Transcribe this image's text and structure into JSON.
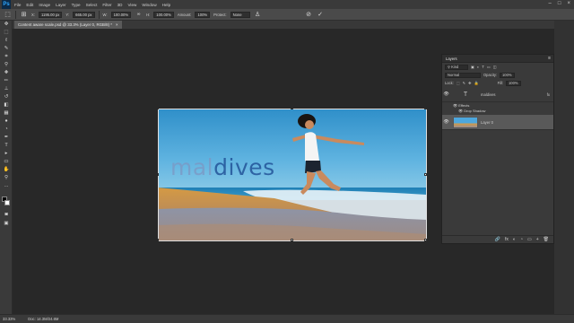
{
  "app": {
    "logo": "Ps"
  },
  "menubar": {
    "items": [
      "File",
      "Edit",
      "Image",
      "Layer",
      "Type",
      "Select",
      "Filter",
      "3D",
      "View",
      "Window",
      "Help"
    ],
    "window_buttons": [
      "–",
      "□",
      "×"
    ]
  },
  "options": {
    "x_label": "X:",
    "x_value": "1195.00 px",
    "y_label": "Y:",
    "y_value": "665.00 px",
    "w_label": "W:",
    "w_value": "100.00%",
    "h_label": "H:",
    "h_value": "100.00%",
    "angle_label": "Δ",
    "angle_value": "0.00",
    "amount_label": "Amount:",
    "amount_value": "100%",
    "protect_label": "Protect:",
    "protect_value": "None",
    "cancel_icon": "⊘",
    "commit_icon": "✓"
  },
  "document": {
    "tab_title": "Content aware scale.psd @ 33.3% (Layer 0, RGB/8) *",
    "tab_close": "×",
    "headline_part1": "mal",
    "headline_part2": "dives"
  },
  "layers_panel": {
    "title": "Layers",
    "menu_icon": "≡",
    "kind_label": "Kind",
    "blend_mode": "Normal",
    "opacity_label": "Opacity:",
    "opacity_value": "100%",
    "lock_label": "Lock:",
    "fill_label": "Fill:",
    "fill_value": "100%",
    "layers": [
      {
        "name": "maldives",
        "type": "text",
        "fx": "fx"
      },
      {
        "name": "Layer 0",
        "type": "image"
      }
    ],
    "effects_label": "Effects",
    "drop_shadow_label": "Drop Shadow",
    "footer_icons": [
      "🔗",
      "fx",
      "◐",
      "◔",
      "▭",
      "+",
      "🗑"
    ]
  },
  "status": {
    "zoom": "33.33%",
    "doc_info": "Doc: 14.3M/24.6M"
  },
  "colors": {
    "accent": "#31a8ff",
    "panel_bg": "#3a3a3a",
    "canvas_bg": "#282828",
    "selected_layer": "#595959"
  }
}
